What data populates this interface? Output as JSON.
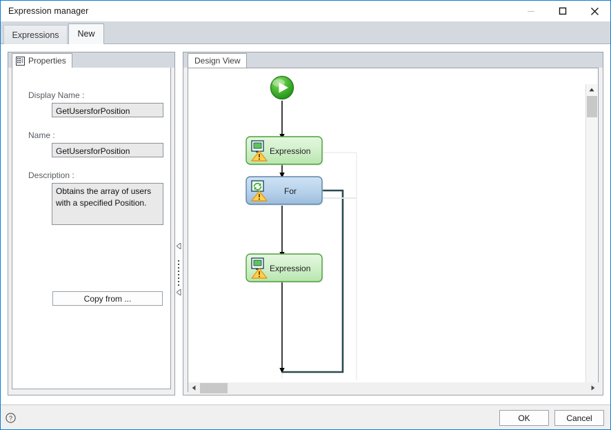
{
  "window": {
    "title": "Expression manager",
    "controls": {
      "minimize": "minimize-button",
      "maximize": "maximize-button",
      "close": "close-button"
    }
  },
  "tabs": [
    {
      "label": "Expressions",
      "active": false
    },
    {
      "label": "New",
      "active": true
    }
  ],
  "properties_panel": {
    "tab_label": "Properties",
    "tab_icon": "properties-grid-icon",
    "fields": [
      {
        "label": "Display Name :",
        "value": "GetUsersforPosition"
      },
      {
        "label": "Name :",
        "value": "GetUsersforPosition"
      },
      {
        "label": "Description :",
        "value": "Obtains the array of users with a specified Position."
      }
    ],
    "copy_from_label": "Copy from ..."
  },
  "splitter": {
    "collapse_icon": "collapse-left-arrow-icon",
    "grip_icon": "splitter-grip-icon"
  },
  "design_panel": {
    "tab_label": "Design View",
    "nodes": [
      {
        "id": "start",
        "type": "start",
        "label": "",
        "icon": "play-start-icon",
        "color": "#3aa82d"
      },
      {
        "id": "expr1",
        "type": "activity",
        "label": "Expression",
        "icon": "expression-monitor-icon",
        "warning": true,
        "color": "#d8f2d3"
      },
      {
        "id": "for",
        "type": "activity",
        "label": "For",
        "icon": "loop-refresh-icon",
        "warning": true,
        "color": "#bdd7ee"
      },
      {
        "id": "expr2",
        "type": "activity",
        "label": "Expression",
        "icon": "expression-monitor-icon",
        "warning": true,
        "color": "#d8f2d3"
      }
    ],
    "connectors": [
      {
        "from": "start",
        "to": "expr1"
      },
      {
        "from": "expr1",
        "to": "for"
      },
      {
        "from": "for",
        "to": "expr2"
      },
      {
        "from": "expr2",
        "to": "for",
        "style": "loopback",
        "color": "#2b4a4f"
      }
    ],
    "scrollbars": {
      "vertical_up": "scroll-up-icon",
      "vertical_down": "scroll-down-icon",
      "horizontal_left": "scroll-left-icon",
      "horizontal_right": "scroll-right-icon"
    }
  },
  "footer": {
    "help_icon": "help-question-icon",
    "ok_label": "OK",
    "cancel_label": "Cancel"
  },
  "colors": {
    "accent_border": "#0a7cd4",
    "tabstrip_bg": "#d4d9e0",
    "node_green": "#d8f2d3",
    "node_green_border": "#4e9f3d",
    "node_blue": "#bdd7ee",
    "node_blue_border": "#5b86a8",
    "warning_orange": "#f5a623",
    "connector_dark": "#2b4a4f"
  }
}
